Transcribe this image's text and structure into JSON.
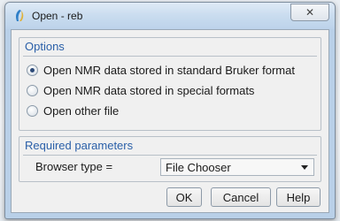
{
  "window": {
    "title": "Open - reb",
    "close_glyph": "✕",
    "app_icon": "python-feather-icon"
  },
  "options": {
    "title": "Options",
    "items": [
      {
        "label": "Open NMR data stored in standard Bruker format",
        "checked": true
      },
      {
        "label": "Open NMR data stored in special formats",
        "checked": false
      },
      {
        "label": "Open other file",
        "checked": false
      }
    ]
  },
  "required": {
    "title": "Required parameters",
    "browser_label": "Browser type =",
    "browser_value": "File Chooser"
  },
  "buttons": {
    "ok": "OK",
    "cancel": "Cancel",
    "help": "Help"
  }
}
